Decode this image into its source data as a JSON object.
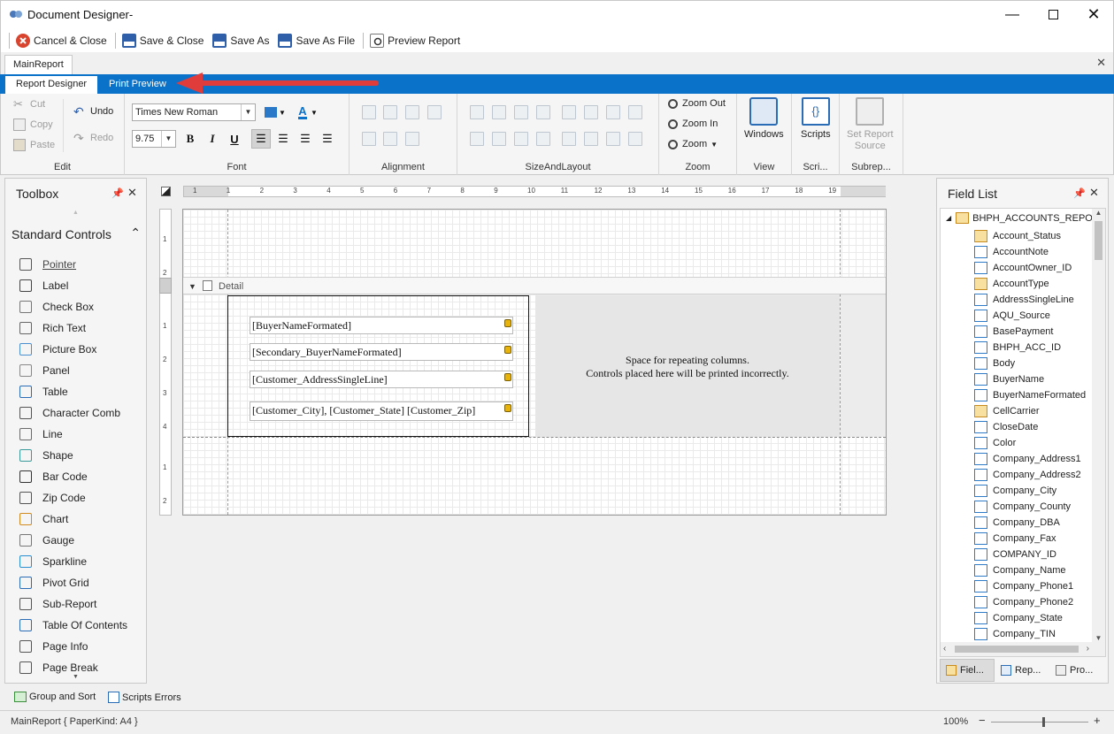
{
  "window": {
    "title": "Document Designer-",
    "minimize_icon": "minimize-icon",
    "maximize_icon": "maximize-icon",
    "close_icon": "close-icon"
  },
  "quick_access": {
    "cancel_close": "Cancel & Close",
    "save_close": "Save & Close",
    "save_as": "Save As",
    "save_as_file": "Save As File",
    "preview_report": "Preview Report"
  },
  "doc_tab": {
    "label": "MainReport"
  },
  "ribbon_tabs": {
    "designer": "Report Designer",
    "preview": "Print Preview"
  },
  "ribbon": {
    "edit": {
      "caption": "Edit",
      "cut": "Cut",
      "copy": "Copy",
      "paste": "Paste",
      "undo": "Undo",
      "redo": "Redo"
    },
    "font": {
      "caption": "Font",
      "family": "Times New Roman",
      "size": "9.75",
      "bold": "B",
      "italic": "I",
      "underline": "U",
      "font_color_glyph": "A"
    },
    "alignment": {
      "caption": "Alignment"
    },
    "size_layout": {
      "caption": "SizeAndLayout"
    },
    "zoom": {
      "caption": "Zoom",
      "zoom_out": "Zoom Out",
      "zoom_in": "Zoom In",
      "zoom": "Zoom"
    },
    "view": {
      "caption": "View",
      "windows": "Windows"
    },
    "scripts": {
      "caption": "Scri...",
      "scripts": "Scripts"
    },
    "subreport": {
      "caption": "Subrep...",
      "set_source_line1": "Set Report",
      "set_source_line2": "Source"
    }
  },
  "toolbox": {
    "title": "Toolbox",
    "section": "Standard Controls",
    "items": [
      "Pointer",
      "Label",
      "Check Box",
      "Rich Text",
      "Picture Box",
      "Panel",
      "Table",
      "Character Comb",
      "Line",
      "Shape",
      "Bar Code",
      "Zip Code",
      "Chart",
      "Gauge",
      "Sparkline",
      "Pivot Grid",
      "Sub-Report",
      "Table Of Contents",
      "Page Info",
      "Page Break"
    ]
  },
  "ruler": {
    "marks": [
      "1",
      "1",
      "2",
      "3",
      "4",
      "5",
      "6",
      "7",
      "8",
      "9",
      "10",
      "11",
      "12",
      "13",
      "14",
      "15",
      "16",
      "17",
      "18",
      "19"
    ]
  },
  "vruler": {
    "top": [
      "1",
      "2"
    ],
    "detail": [
      "1",
      "2",
      "3",
      "4"
    ],
    "bottom": [
      "1",
      "2"
    ]
  },
  "report": {
    "band": "Detail",
    "fields": [
      "[BuyerNameFormated]",
      "[Secondary_BuyerNameFormated]",
      "[Customer_AddressSingleLine]",
      "[Customer_City], [Customer_State] [Customer_Zip]"
    ],
    "repeat_note_line1": "Space for repeating columns.",
    "repeat_note_line2": "Controls placed here will be printed incorrectly."
  },
  "field_list": {
    "title": "Field List",
    "root": "BHPH_ACCOUNTS_REPORT",
    "items": [
      {
        "name": "Account_Status",
        "type": "tbl"
      },
      {
        "name": "AccountNote",
        "type": "ab"
      },
      {
        "name": "AccountOwner_ID",
        "type": "123"
      },
      {
        "name": "AccountType",
        "type": "tbl"
      },
      {
        "name": "AddressSingleLine",
        "type": "ab"
      },
      {
        "name": "AQU_Source",
        "type": "ab"
      },
      {
        "name": "BasePayment",
        "type": "1.3"
      },
      {
        "name": "BHPH_ACC_ID",
        "type": "123"
      },
      {
        "name": "Body",
        "type": "ab"
      },
      {
        "name": "BuyerName",
        "type": "ab"
      },
      {
        "name": "BuyerNameFormated",
        "type": "ab"
      },
      {
        "name": "CellCarrier",
        "type": "tbl"
      },
      {
        "name": "CloseDate",
        "type": "clk"
      },
      {
        "name": "Color",
        "type": "ab"
      },
      {
        "name": "Company_Address1",
        "type": "ab"
      },
      {
        "name": "Company_Address2",
        "type": "ab"
      },
      {
        "name": "Company_City",
        "type": "ab"
      },
      {
        "name": "Company_County",
        "type": "ab"
      },
      {
        "name": "Company_DBA",
        "type": "ab"
      },
      {
        "name": "Company_Fax",
        "type": "ab"
      },
      {
        "name": "COMPANY_ID",
        "type": "123"
      },
      {
        "name": "Company_Name",
        "type": "ab"
      },
      {
        "name": "Company_Phone1",
        "type": "ab"
      },
      {
        "name": "Company_Phone2",
        "type": "ab"
      },
      {
        "name": "Company_State",
        "type": "ab"
      },
      {
        "name": "Company_TIN",
        "type": "ab"
      }
    ],
    "tabs": [
      "Fiel...",
      "Rep...",
      "Pro..."
    ]
  },
  "bottom": {
    "group_sort": "Group and Sort",
    "script_errors": "Scripts Errors"
  },
  "status": {
    "left": "MainReport { PaperKind: A4 }",
    "zoom": "100%",
    "minus": "−",
    "plus": "+"
  },
  "colors": {
    "accent": "#0a72c9",
    "arrow": "#e03c3c"
  }
}
